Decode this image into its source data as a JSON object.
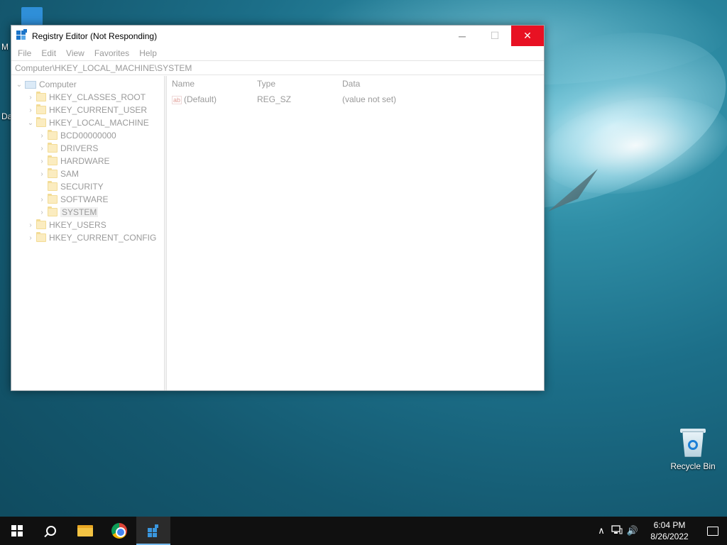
{
  "window": {
    "title": "Registry Editor (Not Responding)",
    "menu": [
      "File",
      "Edit",
      "View",
      "Favorites",
      "Help"
    ],
    "address": "Computer\\HKEY_LOCAL_MACHINE\\SYSTEM",
    "controls": {
      "minimize": "─",
      "maximize": "☐",
      "close": "✕"
    }
  },
  "tree": {
    "root": "Computer",
    "hklm_children": [
      "BCD00000000",
      "DRIVERS",
      "HARDWARE",
      "SAM",
      "SECURITY",
      "SOFTWARE",
      "SYSTEM"
    ],
    "hives": [
      "HKEY_CLASSES_ROOT",
      "HKEY_CURRENT_USER",
      "HKEY_LOCAL_MACHINE",
      "HKEY_USERS",
      "HKEY_CURRENT_CONFIG"
    ],
    "selected": "SYSTEM"
  },
  "values": {
    "headers": {
      "name": "Name",
      "type": "Type",
      "data": "Data"
    },
    "rows": [
      {
        "icon": "string-value-icon",
        "icon_text": "ab",
        "name": "(Default)",
        "type": "REG_SZ",
        "data": "(value not set)"
      }
    ]
  },
  "desktop": {
    "recycle_bin": "Recycle Bin",
    "peek_1": "M",
    "peek_2": "Da"
  },
  "taskbar": {
    "time": "6:04 PM",
    "date": "8/26/2022",
    "tray_chevron": "∧",
    "volume": "🔊"
  },
  "colors": {
    "close_button": "#e81123",
    "taskbar": "#101010",
    "active_indicator": "#76b9ed"
  }
}
